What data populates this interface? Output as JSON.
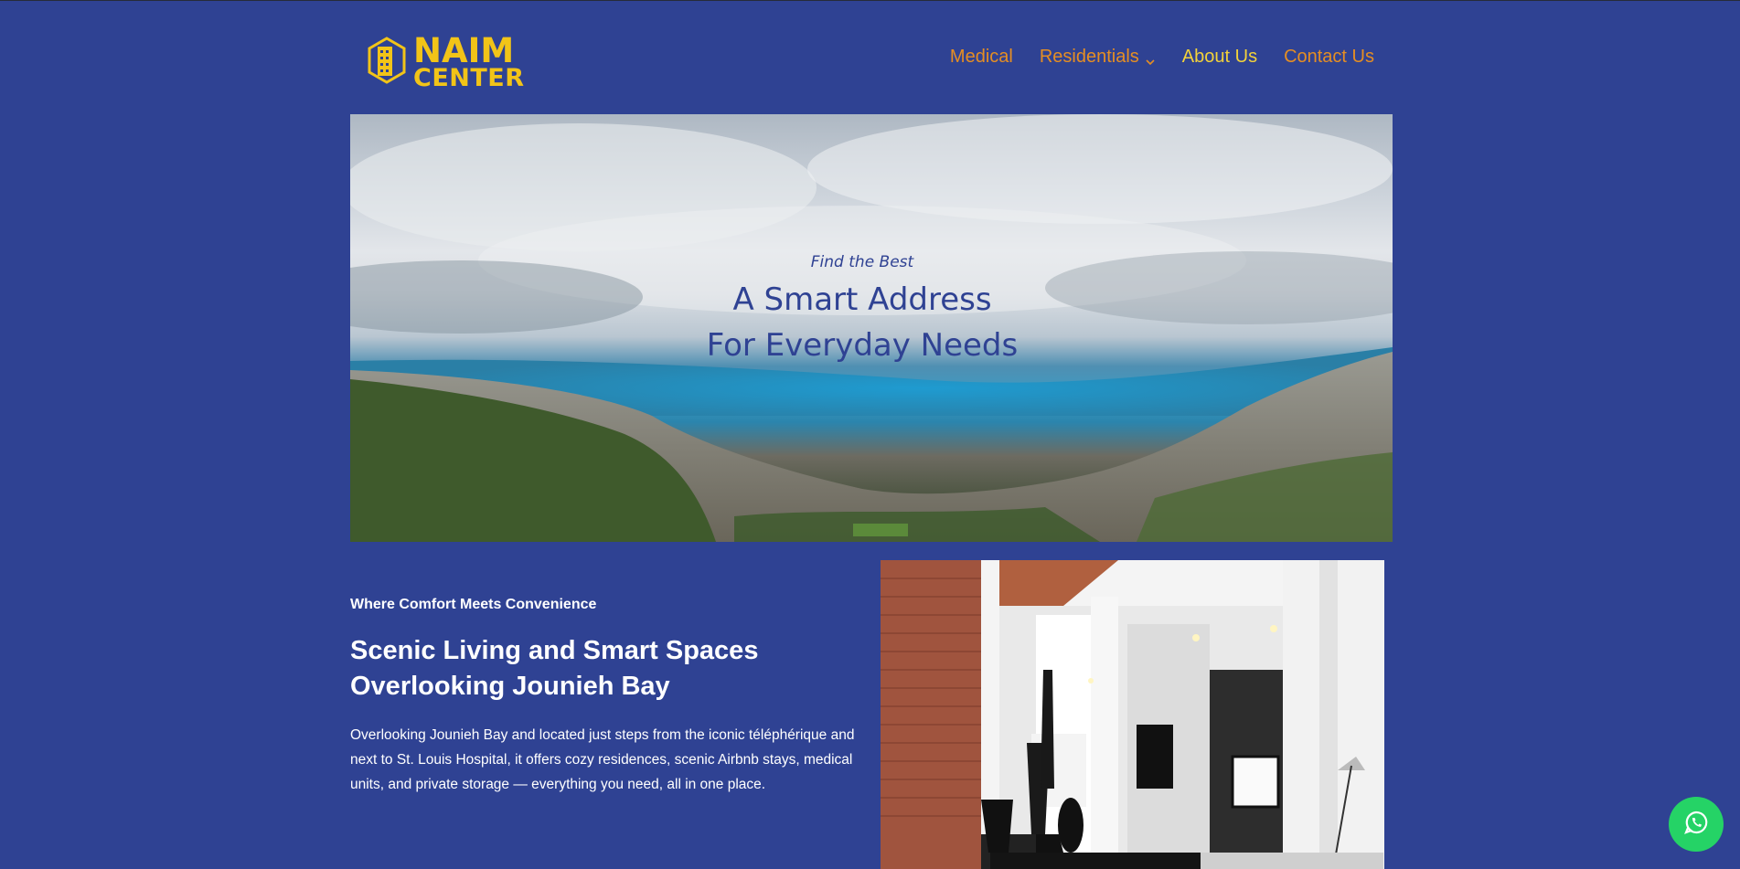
{
  "brand": {
    "line1": "NAIM",
    "line2": "CENTER",
    "logo_icon": "building-icon",
    "color": "#f2c418"
  },
  "nav": {
    "items": [
      {
        "label": "Medical"
      },
      {
        "label": "Residentials",
        "has_dropdown": true
      },
      {
        "label": "About Us",
        "active": true
      },
      {
        "label": "Contact Us"
      }
    ]
  },
  "hero": {
    "kicker": "Find the Best",
    "title_line1": "A Smart Address",
    "title_line2": "For Everyday Needs"
  },
  "intro": {
    "eyebrow": "Where Comfort Meets Convenience",
    "headline_line1": "Scenic Living and Smart Spaces",
    "headline_line2": "Overlooking Jounieh Bay",
    "body": "Overlooking Jounieh Bay and located just steps from the iconic téléphérique and next to St. Louis Hospital, it offers cozy residences, scenic Airbnb stays, medical units, and private storage — everything you need, all in one place."
  },
  "floating": {
    "icon": "whatsapp-icon",
    "color": "#25d366"
  },
  "colors": {
    "background": "#2f4293",
    "nav_text": "#e58e23",
    "nav_active": "#f3d23a"
  }
}
